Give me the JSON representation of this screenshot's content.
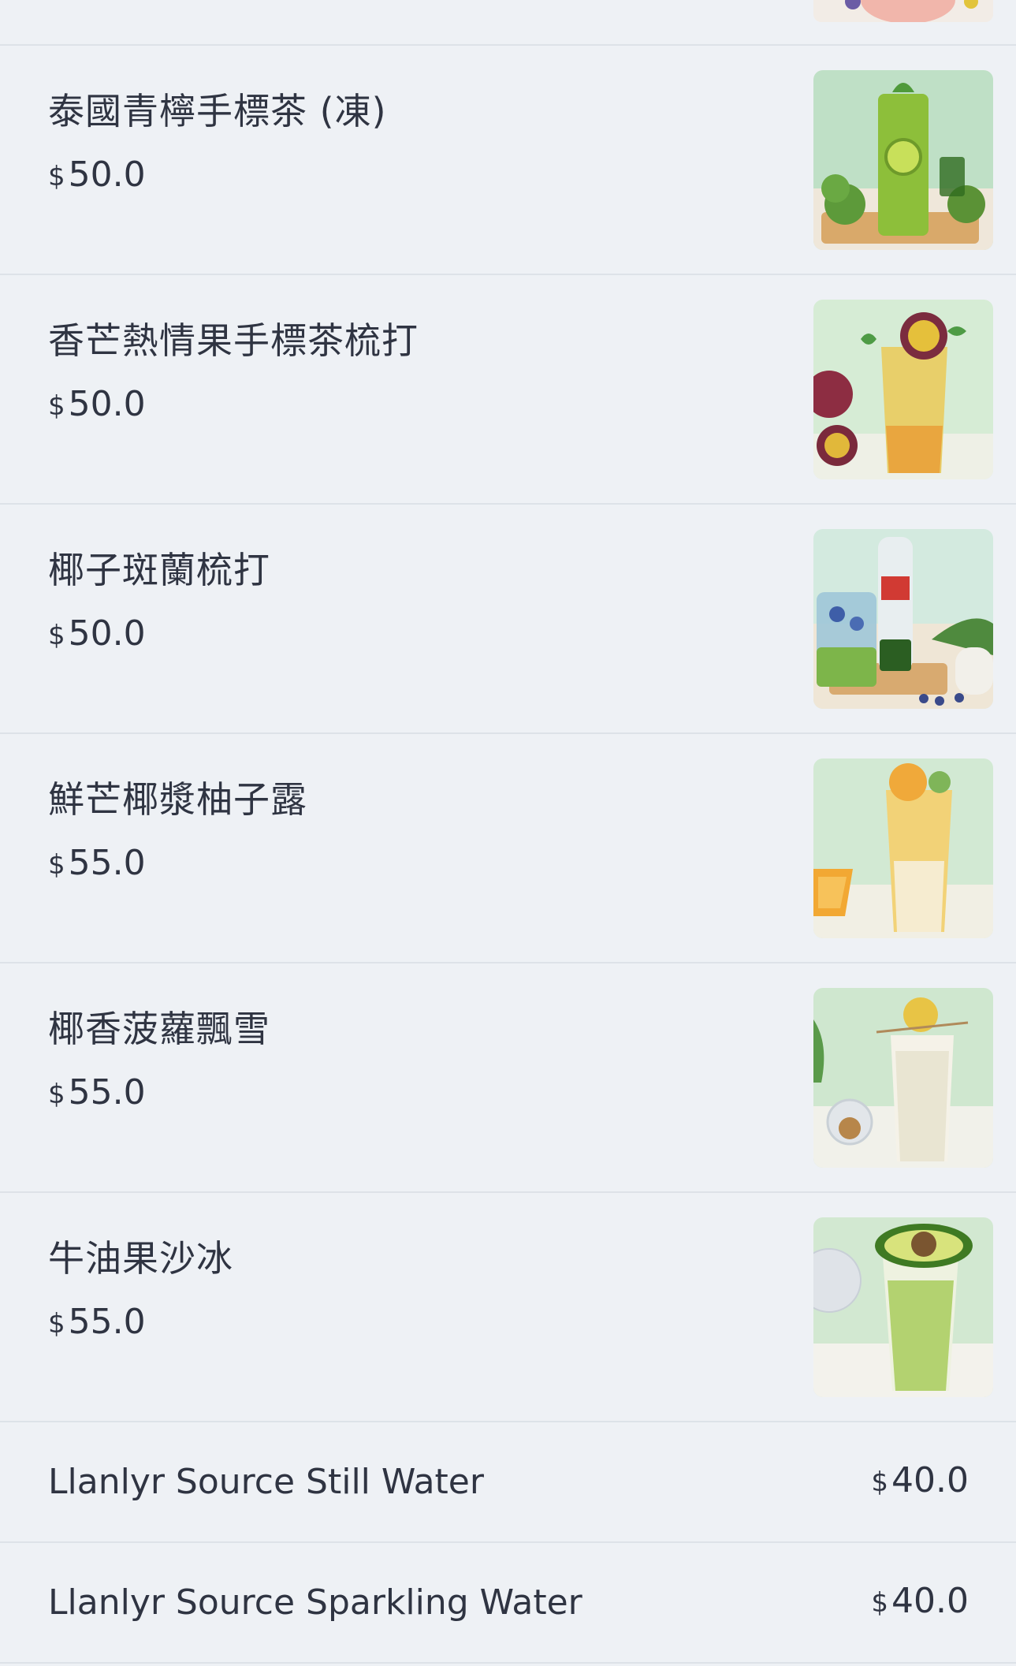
{
  "currency_symbol": "$",
  "items": [
    {
      "name": "泰國青檸手標茶 (凍)",
      "price": "50.0",
      "image": "lime-tea-drink"
    },
    {
      "name": "香芒熱情果手標茶梳打",
      "price": "50.0",
      "image": "passionfruit-mango-soda"
    },
    {
      "name": "椰子斑蘭梳打",
      "price": "50.0",
      "image": "coconut-pandan-soda"
    },
    {
      "name": "鮮芒椰漿柚子露",
      "price": "55.0",
      "image": "mango-coconut-pomelo"
    },
    {
      "name": "椰香菠蘿飄雪",
      "price": "55.0",
      "image": "coconut-pineapple-slush"
    },
    {
      "name": "牛油果沙冰",
      "price": "55.0",
      "image": "avocado-smoothie"
    }
  ],
  "simple_items": [
    {
      "name": "Llanlyr Source Still Water",
      "price": "40.0"
    },
    {
      "name": "Llanlyr Source Sparkling Water",
      "price": "40.0"
    }
  ],
  "colors": {
    "background": "#eef1f5",
    "divider": "#dde2e8",
    "text": "#2f3442"
  }
}
